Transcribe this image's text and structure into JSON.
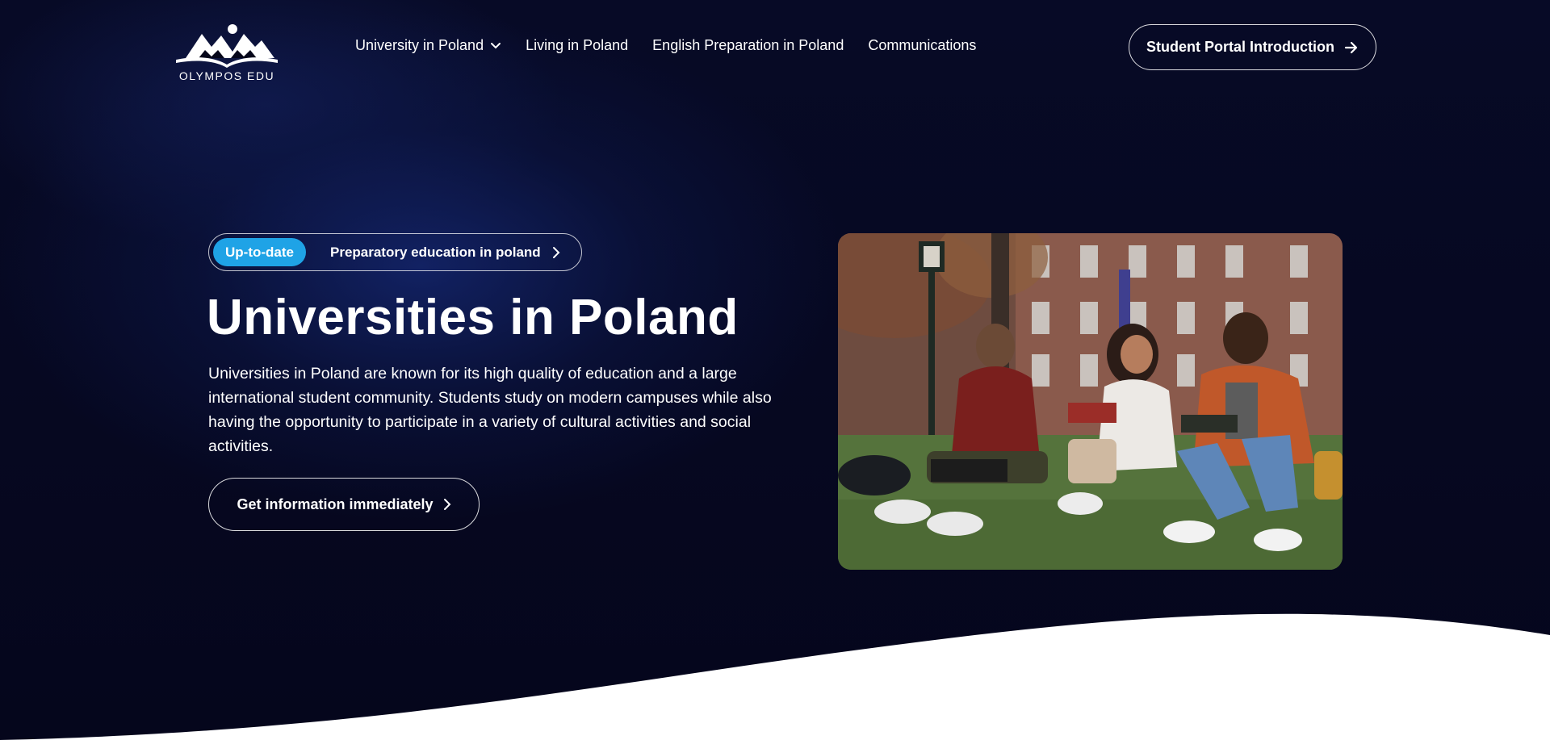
{
  "brand": {
    "name": "OLYMPOS EDU",
    "logo_icon": "book-mountains-icon"
  },
  "nav": {
    "items": [
      {
        "label": "University in Poland",
        "has_dropdown": true
      },
      {
        "label": "Living in Poland"
      },
      {
        "label": "English Preparation in Poland"
      },
      {
        "label": "Communications"
      }
    ],
    "portal_button": {
      "label": "Student Portal Introduction",
      "icon": "arrow-right-icon"
    }
  },
  "hero": {
    "badge": "Up-to-date",
    "badge_link": "Preparatory education in poland",
    "title": "Universities in Poland",
    "description": "Universities in Poland are known for its high quality of education and a large international student community. Students study on modern campuses while also having the opportunity to participate in a variety of cultural activities and social activities.",
    "cta_label": "Get information immediately",
    "image_icon": "students-on-campus-photo"
  },
  "colors": {
    "background": "#05061a",
    "accent": "#1fa3e6",
    "text": "#ffffff",
    "wave": "#ffffff"
  }
}
